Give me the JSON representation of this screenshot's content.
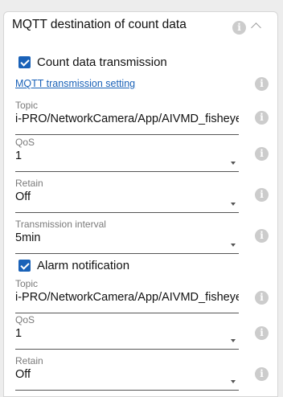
{
  "section": {
    "title": "MQTT destination of count data",
    "info_glyph": "i"
  },
  "count_data": {
    "checkbox_label": "Count data transmission",
    "checked": true,
    "link_text": "MQTT transmission setting",
    "topic": {
      "label": "Topic",
      "value": "i-PRO/NetworkCamera/App/AIVMD_fisheye"
    },
    "qos": {
      "label": "QoS",
      "value": "1"
    },
    "retain": {
      "label": "Retain",
      "value": "Off"
    },
    "interval": {
      "label": "Transmission interval",
      "value": "5min"
    }
  },
  "alarm": {
    "checkbox_label": "Alarm notification",
    "checked": true,
    "topic": {
      "label": "Topic",
      "value": "i-PRO/NetworkCamera/App/AIVMD_fisheye"
    },
    "qos": {
      "label": "QoS",
      "value": "1"
    },
    "retain": {
      "label": "Retain",
      "value": "Off"
    }
  },
  "colors": {
    "accent": "#1a62b8",
    "info_icon": "#cccccc",
    "label": "#7a7a7a"
  }
}
